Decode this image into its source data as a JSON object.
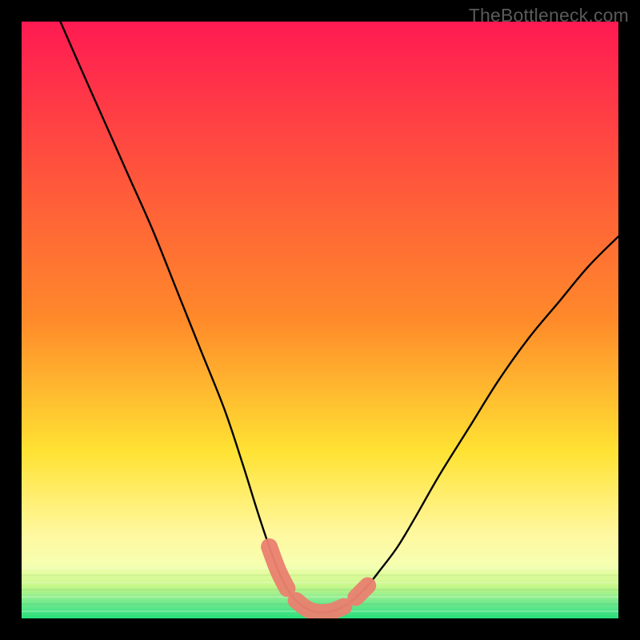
{
  "watermark": "TheBottleneck.com",
  "chart_data": {
    "type": "line",
    "title": "",
    "xlabel": "",
    "ylabel": "",
    "xlim": [
      0,
      100
    ],
    "ylim": [
      0,
      100
    ],
    "grid": false,
    "x": [
      6.5,
      10,
      14,
      18,
      22,
      26,
      30,
      34,
      37,
      39.5,
      41.5,
      43,
      44.5,
      46,
      48,
      50,
      52,
      54,
      56,
      58,
      60,
      63,
      66,
      70,
      75,
      80,
      85,
      90,
      95,
      100
    ],
    "y": [
      100,
      92,
      83,
      74,
      65,
      55,
      45,
      35,
      26,
      18,
      12,
      8,
      5,
      3,
      1.5,
      1,
      1.2,
      2,
      3.5,
      5.5,
      8,
      12,
      17,
      24,
      32,
      40,
      47,
      53,
      59,
      64
    ],
    "highlight_segments": [
      {
        "x_start": 41.5,
        "x_end": 44.5
      },
      {
        "x_start": 46.0,
        "x_end": 54.0
      },
      {
        "x_start": 56.0,
        "x_end": 58.0
      }
    ],
    "background_gradient": {
      "top": "#ff1a52",
      "mid1": "#ff8a2a",
      "mid2": "#ffe233",
      "band": "#fff8a0",
      "bottom": "#26e07a"
    }
  }
}
